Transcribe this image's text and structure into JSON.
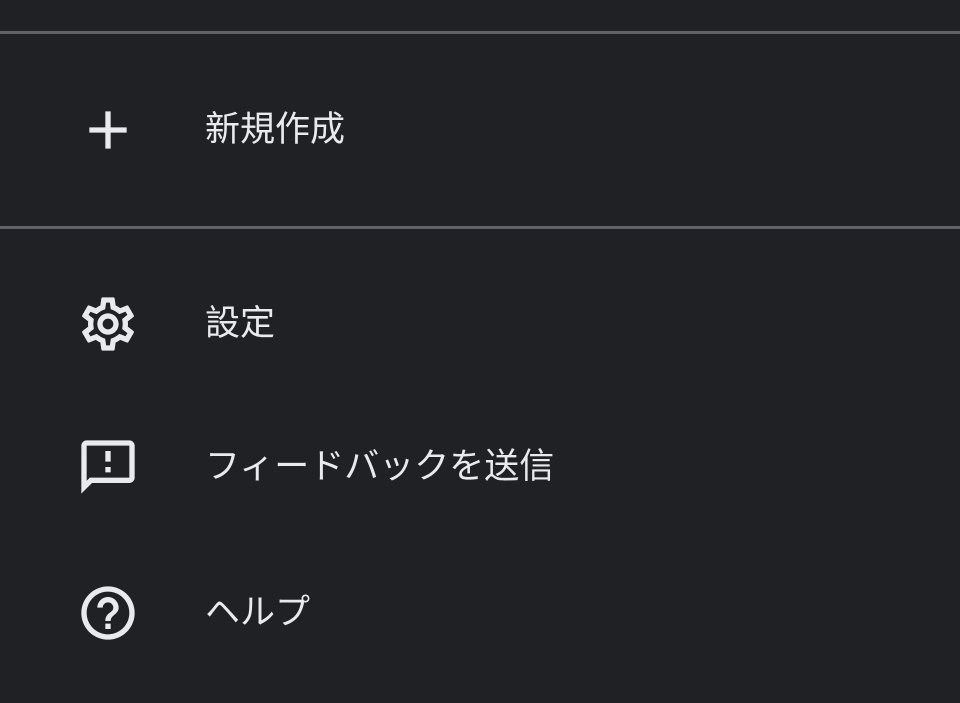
{
  "menu": {
    "items": [
      {
        "label": "新規作成",
        "icon": "plus-icon"
      },
      {
        "label": "設定",
        "icon": "gear-icon"
      },
      {
        "label": "フィードバックを送信",
        "icon": "feedback-icon"
      },
      {
        "label": "ヘルプ",
        "icon": "help-icon"
      }
    ]
  },
  "colors": {
    "background": "#202124",
    "text": "#e8eaed",
    "divider": "#5f6368"
  }
}
